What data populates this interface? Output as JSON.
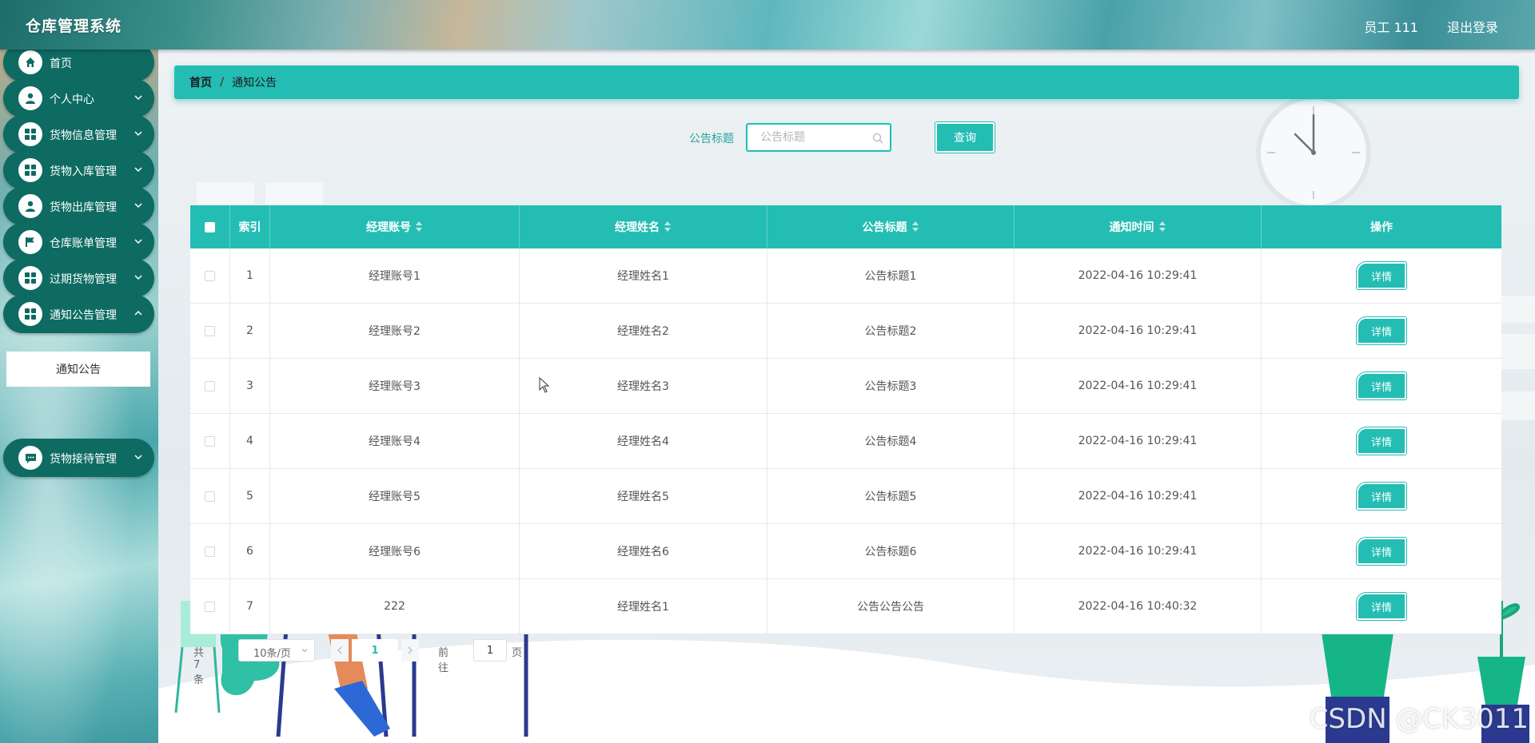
{
  "header": {
    "app_title": "仓库管理系统",
    "user_label": "员工 111",
    "logout_label": "退出登录"
  },
  "sidebar": {
    "items": [
      {
        "label": "首页",
        "icon": "home-icon"
      },
      {
        "label": "个人中心",
        "icon": "user-icon"
      },
      {
        "label": "货物信息管理",
        "icon": "grid-icon"
      },
      {
        "label": "货物入库管理",
        "icon": "grid-icon"
      },
      {
        "label": "货物出库管理",
        "icon": "user-icon"
      },
      {
        "label": "仓库账单管理",
        "icon": "flag-icon"
      },
      {
        "label": "过期货物管理",
        "icon": "grid-icon"
      },
      {
        "label": "通知公告管理",
        "icon": "grid-icon"
      },
      {
        "label": "货物接待管理",
        "icon": "chat-icon"
      }
    ],
    "sub_item": "通知公告"
  },
  "breadcrumb": {
    "home": "首页",
    "separator": "/",
    "current": "通知公告"
  },
  "search": {
    "label": "公告标题",
    "placeholder": "公告标题",
    "value": "",
    "button": "查询"
  },
  "table": {
    "headers": [
      "索引",
      "经理账号",
      "经理姓名",
      "公告标题",
      "通知时间",
      "操作"
    ],
    "rows": [
      {
        "index": "1",
        "account": "经理账号1",
        "name": "经理姓名1",
        "title": "公告标题1",
        "time": "2022-04-16 10:29:41",
        "action": "详情"
      },
      {
        "index": "2",
        "account": "经理账号2",
        "name": "经理姓名2",
        "title": "公告标题2",
        "time": "2022-04-16 10:29:41",
        "action": "详情"
      },
      {
        "index": "3",
        "account": "经理账号3",
        "name": "经理姓名3",
        "title": "公告标题3",
        "time": "2022-04-16 10:29:41",
        "action": "详情"
      },
      {
        "index": "4",
        "account": "经理账号4",
        "name": "经理姓名4",
        "title": "公告标题4",
        "time": "2022-04-16 10:29:41",
        "action": "详情"
      },
      {
        "index": "5",
        "account": "经理账号5",
        "name": "经理姓名5",
        "title": "公告标题5",
        "time": "2022-04-16 10:29:41",
        "action": "详情"
      },
      {
        "index": "6",
        "account": "经理账号6",
        "name": "经理姓名6",
        "title": "公告标题6",
        "time": "2022-04-16 10:29:41",
        "action": "详情"
      },
      {
        "index": "7",
        "account": "222",
        "name": "经理姓名1",
        "title": "公告公告公告",
        "time": "2022-04-16 10:40:32",
        "action": "详情"
      }
    ]
  },
  "pagination": {
    "total": "共 7 条",
    "page_size": "10条/页",
    "current_page": "1",
    "goto_label": "前往",
    "goto_value": "1",
    "page_suffix": "页"
  },
  "watermark": "CSDN @CK3011",
  "colors": {
    "accent": "#23bdb4",
    "sidebar_item": "#0d6b62",
    "header_text": "#ffffff"
  }
}
